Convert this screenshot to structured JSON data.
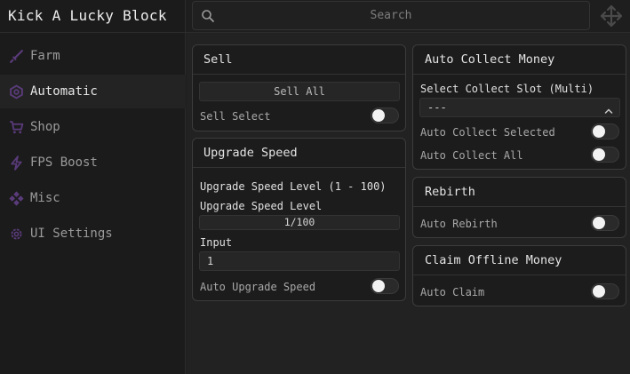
{
  "app": {
    "title": "Kick A Lucky Block"
  },
  "search": {
    "placeholder": "Search"
  },
  "sidebar": {
    "items": [
      {
        "label": "Farm",
        "icon": "sword-icon"
      },
      {
        "label": "Automatic",
        "icon": "hexagon-icon",
        "active": true
      },
      {
        "label": "Shop",
        "icon": "cart-icon"
      },
      {
        "label": "FPS Boost",
        "icon": "lightning-icon"
      },
      {
        "label": "Misc",
        "icon": "diamond-cluster-icon"
      },
      {
        "label": "UI Settings",
        "icon": "gear-icon"
      }
    ]
  },
  "sell": {
    "title": "Sell",
    "sell_all_label": "Sell All",
    "sell_select_label": "Sell Select",
    "sell_select_on": false
  },
  "upgrade_speed": {
    "title": "Upgrade Speed",
    "level_range_label": "Upgrade Speed Level (1 - 100)",
    "level_label": "Upgrade Speed Level",
    "level_value": "1/100",
    "input_label": "Input",
    "input_value": "1",
    "auto_label": "Auto Upgrade Speed",
    "auto_on": false
  },
  "auto_collect": {
    "title": "Auto Collect Money",
    "slot_label": "Select Collect Slot (Multi)",
    "slot_value": "---",
    "selected_label": "Auto Collect Selected",
    "selected_on": false,
    "all_label": "Auto Collect All",
    "all_on": false
  },
  "rebirth": {
    "title": "Rebirth",
    "auto_label": "Auto Rebirth",
    "auto_on": false
  },
  "offline_money": {
    "title": "Claim Offline Money",
    "auto_label": "Auto Claim",
    "auto_on": false
  },
  "colors": {
    "background": "#1e1e1e",
    "panel": "#1c1c1c",
    "accent_icon": "#5a3b7a",
    "toggle_knob": "#f2f2f2"
  }
}
